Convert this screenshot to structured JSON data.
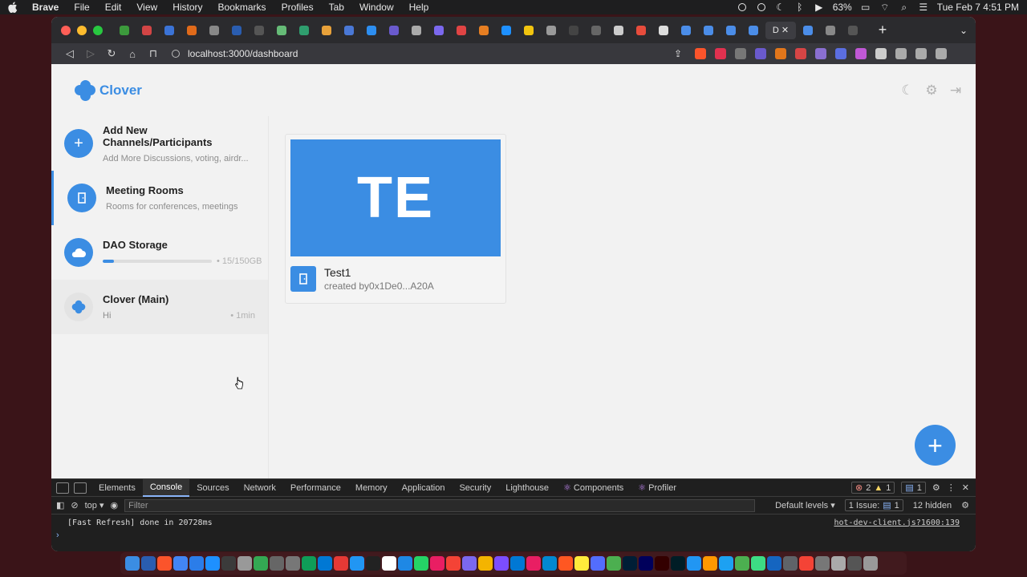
{
  "menubar": {
    "items": [
      "Brave",
      "File",
      "Edit",
      "View",
      "History",
      "Bookmarks",
      "Profiles",
      "Tab",
      "Window",
      "Help"
    ],
    "battery": "63%",
    "datetime": "Tue Feb 7  4:51 PM"
  },
  "browser": {
    "url": "localhost:3000/dashboard",
    "active_tab_label": "D"
  },
  "app": {
    "name": "Clover",
    "sidebar": {
      "items": [
        {
          "title": "Add New Channels/Participants",
          "subtitle": "Add More Discussions, voting, airdr...",
          "meta": ""
        },
        {
          "title": "Meeting Rooms",
          "subtitle": "Rooms for conferences, meetings",
          "meta": ""
        },
        {
          "title": "DAO Storage",
          "subtitle": "",
          "meta": "15/150GB",
          "progress": 0.1
        },
        {
          "title": "Clover (Main)",
          "subtitle": "Hi",
          "meta": "1min"
        }
      ]
    },
    "room_card": {
      "initials": "TE",
      "name": "Test1",
      "creator": "created by0x1De0...A20A"
    }
  },
  "devtools": {
    "tabs": [
      "Elements",
      "Console",
      "Sources",
      "Network",
      "Performance",
      "Memory",
      "Application",
      "Security",
      "Lighthouse",
      "Components",
      "Profiler"
    ],
    "active_tab": "Console",
    "errors": "2",
    "warnings": "1",
    "messages": "1",
    "context": "top",
    "filter_placeholder": "Filter",
    "levels": "Default levels",
    "issues": "1 Issue:",
    "issues_count": "1",
    "hidden": "12 hidden",
    "console": {
      "message": "[Fast Refresh] done in 20728ms",
      "source": "hot-dev-client.js?1600:139"
    }
  },
  "colors": {
    "accent": "#3b8de3",
    "app_bg": "#f2f2f2"
  }
}
